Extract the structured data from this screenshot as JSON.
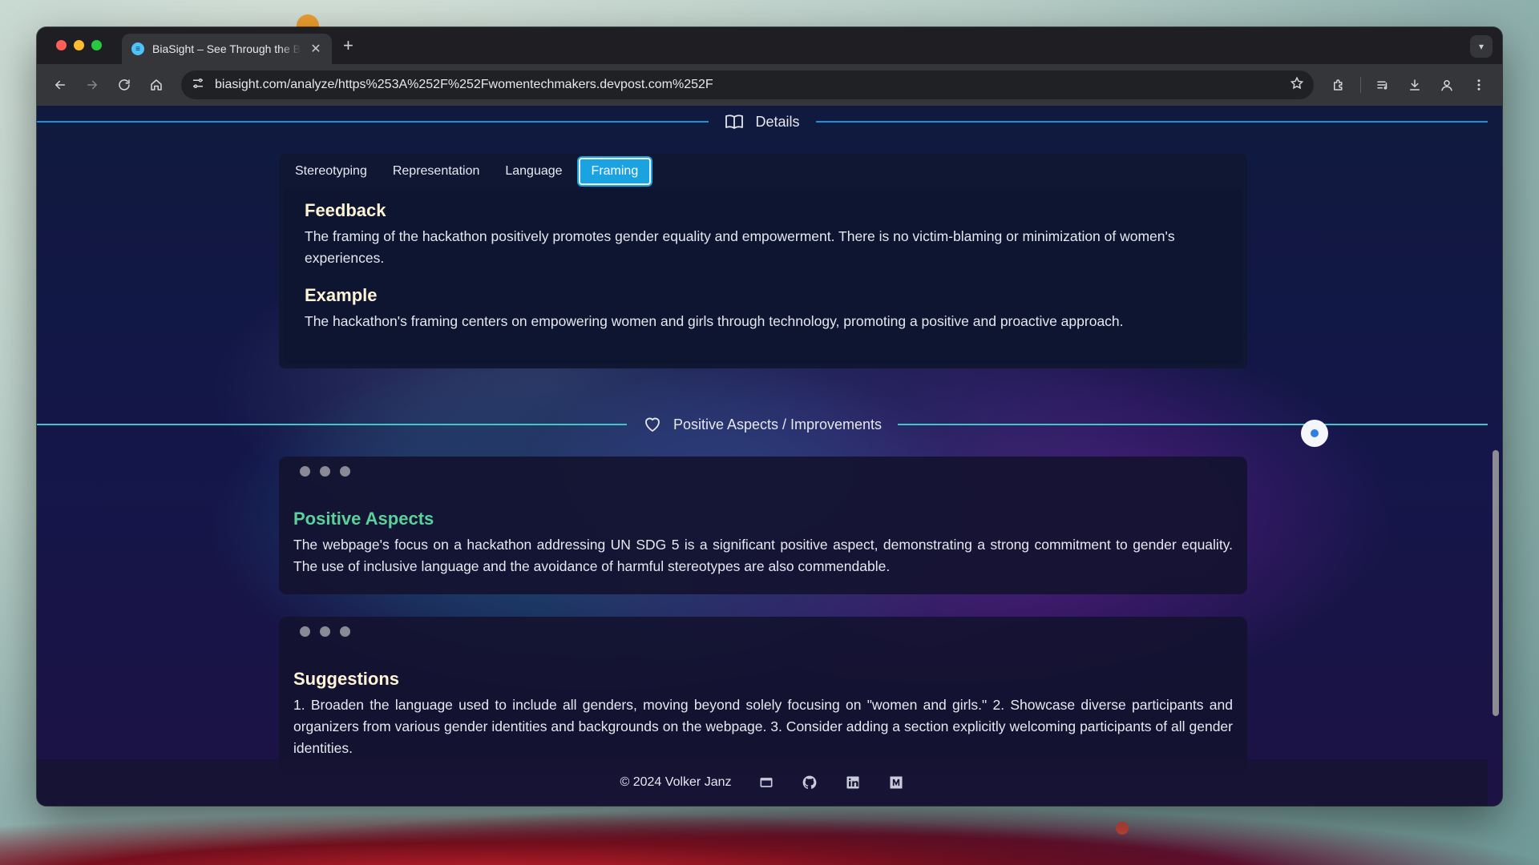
{
  "browser": {
    "tab_title": "BiaSight – See Through the Bias",
    "tab_close": "✕",
    "new_tab": "+",
    "url": "biasight.com/analyze/https%253A%252F%252Fwomentechmakers.devpost.com%252F"
  },
  "details": {
    "section_label": "Details",
    "tabs": [
      {
        "label": "Stereotyping"
      },
      {
        "label": "Representation"
      },
      {
        "label": "Language"
      },
      {
        "label": "Framing"
      }
    ],
    "active_tab": "Framing",
    "feedback_title": "Feedback",
    "feedback_text": "The framing of the hackathon positively promotes gender equality and empowerment. There is no victim-blaming or minimization of women's experiences.",
    "example_title": "Example",
    "example_text": "The hackathon's framing centers on empowering women and girls through technology, promoting a positive and proactive approach."
  },
  "aspects": {
    "section_label": "Positive Aspects / Improvements",
    "positive_title": "Positive Aspects",
    "positive_text": "The webpage's focus on a hackathon addressing UN SDG 5 is a significant positive aspect, demonstrating a strong commitment to gender equality. The use of inclusive language and the avoidance of harmful stereotypes are also commendable.",
    "suggestions_title": "Suggestions",
    "suggestions_text": "1. Broaden the language used to include all genders, moving beyond solely focusing on \"women and girls.\" 2. Showcase diverse participants and organizers from various gender identities and backgrounds on the webpage. 3. Consider adding a section explicitly welcoming participants of all gender identities."
  },
  "footer": {
    "copyright": "© 2024 Volker Janz",
    "links": [
      "website-icon",
      "github-icon",
      "linkedin-icon",
      "medium-icon"
    ]
  },
  "colors": {
    "accent": "#1aa3e0",
    "details_line": "#1e8fd8",
    "aspects_line": "#3fc6c9",
    "positive": "#5ad19a",
    "suggestions": "#fff5d6"
  }
}
